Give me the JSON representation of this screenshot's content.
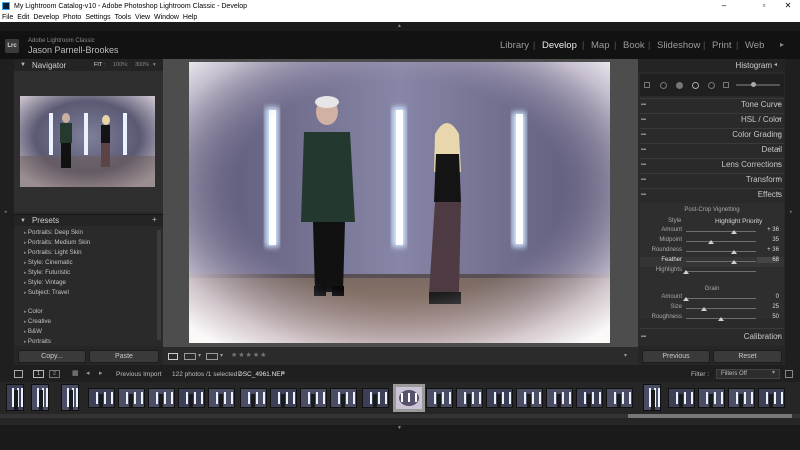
{
  "window": {
    "title": "My Lightroom Catalog-v10 - Adobe Photoshop Lightroom Classic - Develop",
    "minimize": "–",
    "maximize": "▫",
    "close": "✕"
  },
  "menu": [
    "File",
    "Edit",
    "Develop",
    "Photo",
    "Settings",
    "Tools",
    "View",
    "Window",
    "Help"
  ],
  "identity": {
    "logo": "Lrc",
    "catalog": "Adobe Lightroom Classic",
    "user": "Jason Parnell-Brookes"
  },
  "modules": [
    "Library",
    "Develop",
    "Map",
    "Book",
    "Slideshow",
    "Print",
    "Web"
  ],
  "active_module": "Develop",
  "navigator": {
    "title": "Navigator",
    "zoom_fit": "FIT",
    "zoom_100": "100%",
    "zoom_300": "300%"
  },
  "presets": {
    "title": "Presets",
    "add": "+",
    "items": [
      "Portraits: Deep Skin",
      "Portraits: Medium Skin",
      "Portraits: Light Skin",
      "Style: Cinematic",
      "Style: Futuristic",
      "Style: Vintage",
      "Subject: Travel"
    ],
    "groups": [
      "Color",
      "Creative",
      "B&W",
      "Portraits"
    ]
  },
  "left_buttons": {
    "copy": "Copy...",
    "paste": "Paste"
  },
  "right_panel": {
    "histogram": "Histogram",
    "sections": [
      "Tone Curve",
      "HSL / Color",
      "Color Grading",
      "Detail",
      "Lens Corrections",
      "Transform",
      "Effects"
    ],
    "vignette": {
      "title": "Post-Crop Vignetting",
      "style_label": "Style",
      "style_value": "Highlight Priority",
      "sliders": [
        {
          "label": "Amount",
          "value": "+ 36",
          "pos": 0.68
        },
        {
          "label": "Midpoint",
          "value": "35",
          "pos": 0.35
        },
        {
          "label": "Roundness",
          "value": "+ 36",
          "pos": 0.68
        },
        {
          "label": "Feather",
          "value": "68",
          "pos": 0.68
        },
        {
          "label": "Highlights",
          "value": "",
          "pos": 0.0
        }
      ]
    },
    "grain": {
      "title": "Grain",
      "sliders": [
        {
          "label": "Amount",
          "value": "0",
          "pos": 0.0
        },
        {
          "label": "Size",
          "value": "25",
          "pos": 0.25
        },
        {
          "label": "Roughness",
          "value": "50",
          "pos": 0.5
        }
      ]
    },
    "calibration": "Calibration",
    "previous": "Previous",
    "reset": "Reset"
  },
  "toolbar": {
    "stars": "★★★★★"
  },
  "filmstrip": {
    "page1": "1",
    "page2": "2",
    "source": "Previous Import",
    "count": "122 photos /1 selected /",
    "filename": "DSC_4961.NEF",
    "filter_label": "Filter :",
    "filter_value": "Filters Off"
  }
}
